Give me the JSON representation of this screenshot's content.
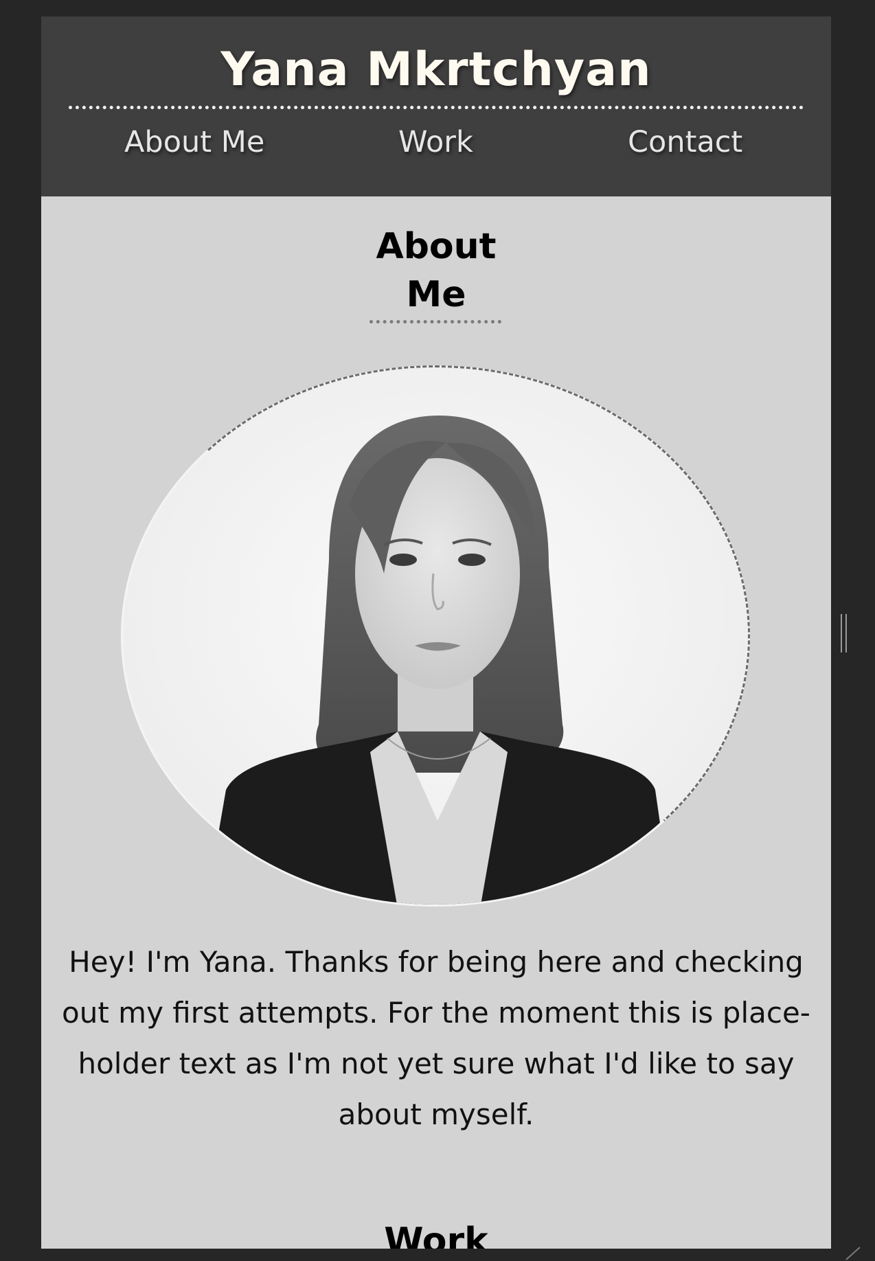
{
  "header": {
    "title": "Yana Mkrtchyan",
    "nav": [
      {
        "label": "About Me"
      },
      {
        "label": "Work"
      },
      {
        "label": "Contact"
      }
    ]
  },
  "about": {
    "heading": "About Me",
    "bio": "Hey! I'm Yana. Thanks for being here and checking out my first attempts. For the moment this is place-holder text as I'm not yet sure what I'd like to say about myself."
  },
  "work": {
    "heading": "Work"
  },
  "colors": {
    "page_background": "#262626",
    "header_background": "#3f3f3f",
    "content_background": "#d3d3d3",
    "title_text": "#fffaf0"
  }
}
